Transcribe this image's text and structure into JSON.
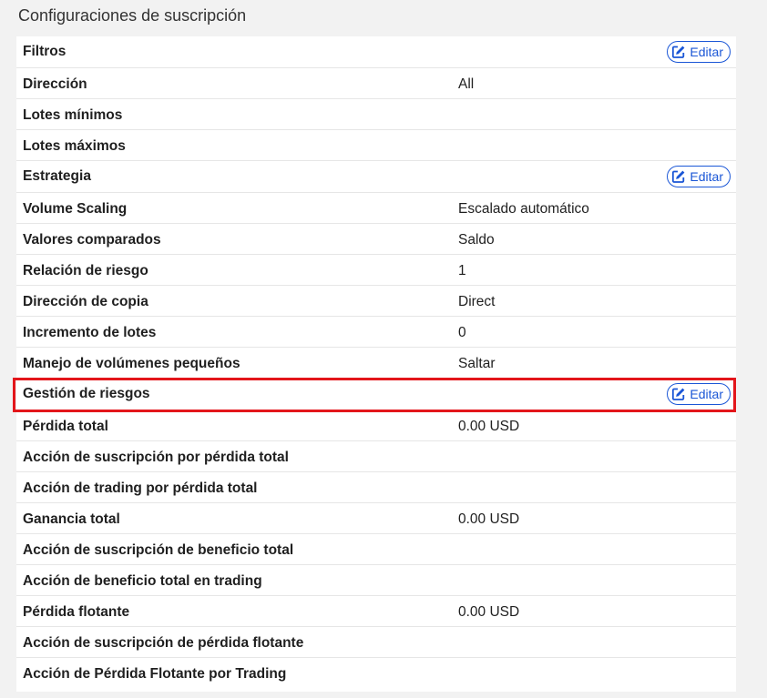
{
  "title": "Configuraciones de suscripción",
  "edit_label": "Editar",
  "colors": {
    "accent": "#1a56d6",
    "highlight": "#e3161b",
    "background": "#f2f2f2"
  },
  "sections": {
    "filters": {
      "label": "Filtros",
      "rows": [
        {
          "label": "Dirección",
          "value": "All"
        },
        {
          "label": "Lotes mínimos",
          "value": ""
        },
        {
          "label": "Lotes máximos",
          "value": ""
        }
      ]
    },
    "strategy": {
      "label": "Estrategia",
      "rows": [
        {
          "label": "Volume Scaling",
          "value": "Escalado automático"
        },
        {
          "label": "Valores comparados",
          "value": "Saldo"
        },
        {
          "label": "Relación de riesgo",
          "value": "1"
        },
        {
          "label": "Dirección de copia",
          "value": "Direct"
        },
        {
          "label": "Incremento de lotes",
          "value": "0"
        },
        {
          "label": "Manejo de volúmenes pequeños",
          "value": "Saltar"
        }
      ]
    },
    "risk": {
      "label": "Gestión de riesgos",
      "rows": [
        {
          "label": "Pérdida total",
          "value": "0.00 USD"
        },
        {
          "label": "Acción de suscripción por pérdida total",
          "value": ""
        },
        {
          "label": "Acción de trading por pérdida total",
          "value": ""
        },
        {
          "label": "Ganancia total",
          "value": "0.00 USD"
        },
        {
          "label": "Acción de suscripción de beneficio total",
          "value": ""
        },
        {
          "label": "Acción de beneficio total en trading",
          "value": ""
        },
        {
          "label": "Pérdida flotante",
          "value": "0.00 USD"
        },
        {
          "label": "Acción de suscripción de pérdida flotante",
          "value": ""
        },
        {
          "label": "Acción de Pérdida Flotante por Trading",
          "value": ""
        }
      ]
    }
  }
}
